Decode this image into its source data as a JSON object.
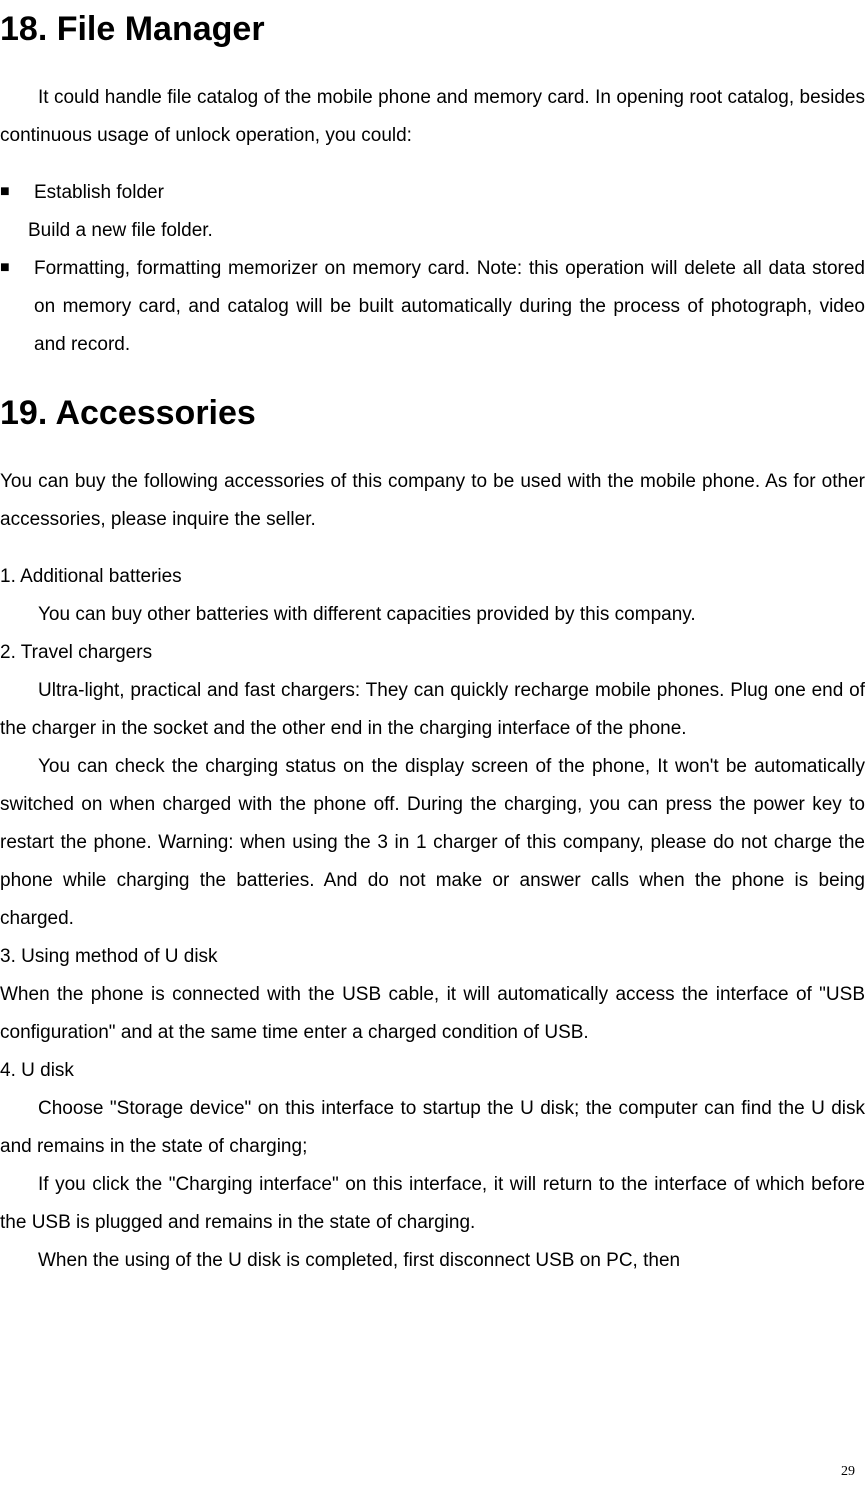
{
  "section18": {
    "heading": "18.  File Manager",
    "intro": "It could handle file catalog of the mobile phone and memory card. In opening root catalog, besides continuous usage of unlock operation, you could:",
    "bullets": [
      {
        "title": "Establish folder",
        "sub": "Build a new file folder."
      },
      {
        "title": "Formatting, formatting memorizer on memory card. Note: this operation will delete all data stored on memory card, and catalog will be built automatically during the process of photograph, video and record."
      }
    ]
  },
  "section19": {
    "heading": "19.  Accessories",
    "intro": "You can buy the following accessories of this company to be used with the mobile phone. As for other accessories, please inquire the seller.",
    "items": [
      {
        "num": "1.   Additional batteries",
        "lines": [
          "You can buy other batteries with different capacities provided by this company."
        ]
      },
      {
        "num": "2.   Travel chargers",
        "lines": [
          "Ultra-light, practical and fast chargers: They can quickly recharge mobile phones. Plug one end of the charger in the socket and the other end in the charging interface of the phone.",
          "You can check the charging status on the display screen of the phone, It won't be automatically switched on when charged with the phone off. During the charging, you can press the power key to restart the phone. Warning: when using the 3 in 1 charger of this company, please do not charge the phone while charging the batteries. And do not make or answer calls when the phone is being charged."
        ]
      },
      {
        "num": "3.   Using method of U disk",
        "plain": "When the phone is connected with the USB cable, it will automatically access the interface of \"USB configuration\" and at the same time enter a charged condition of USB."
      },
      {
        "num": "4.   U disk",
        "lines": [
          "Choose \"Storage device\" on this interface to startup the U disk; the computer can find the U disk and remains in the state of charging;",
          "If you click the \"Charging interface\" on this interface, it will return to the interface of which before the USB is plugged and remains in the state of charging.",
          "When the using of the U disk is completed, first disconnect USB on PC, then"
        ]
      }
    ]
  },
  "page_number": "29"
}
